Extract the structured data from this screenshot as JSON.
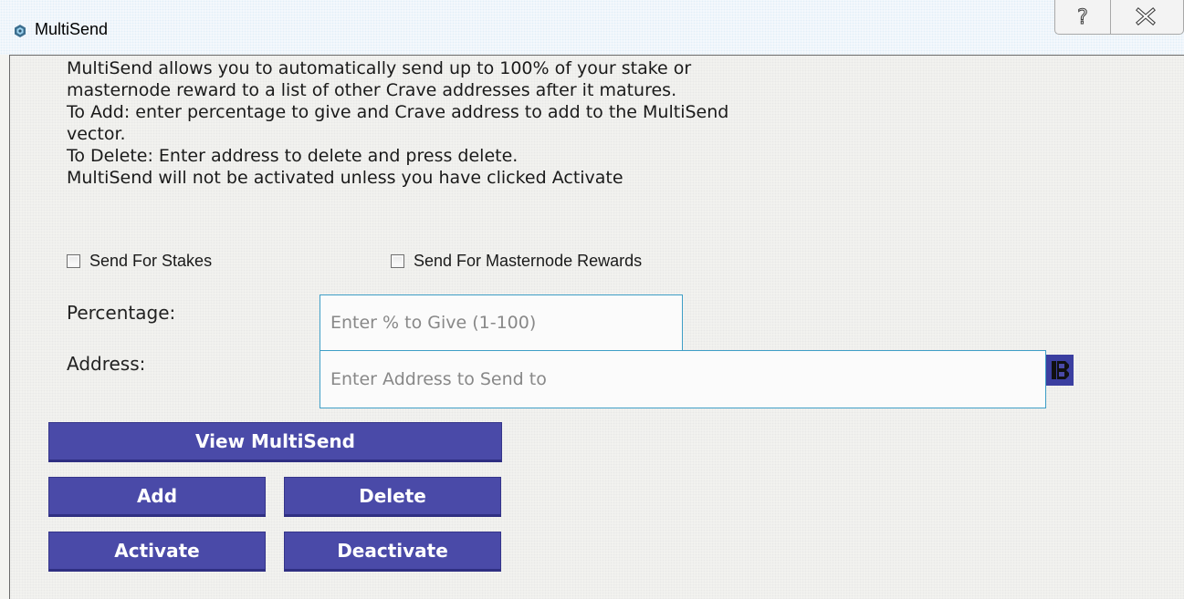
{
  "window": {
    "title": "MultiSend",
    "icons": {
      "app": "multisend-app-icon",
      "help": "help-icon",
      "close": "close-icon",
      "address_book": "address-book-icon"
    }
  },
  "description": {
    "lines": [
      "MultiSend allows you to automatically send up to 100% of your stake or",
      "masternode reward to a list of other Crave addresses after it matures.",
      "To Add: enter percentage to give and Crave address to add to the MultiSend",
      "vector.",
      "To Delete: Enter address to delete and press delete.",
      "MultiSend will not be activated unless you have clicked Activate"
    ]
  },
  "options": {
    "stakes_label": "Send For Stakes",
    "stakes_checked": false,
    "masternode_label": "Send For Masternode Rewards",
    "masternode_checked": false
  },
  "form": {
    "percentage_label": "Percentage:",
    "percentage_placeholder": "Enter % to Give (1-100)",
    "percentage_value": "",
    "address_label": "Address:",
    "address_placeholder": "Enter Address to Send to",
    "address_value": ""
  },
  "buttons": {
    "view": "View MultiSend",
    "add": "Add",
    "delete": "Delete",
    "activate": "Activate",
    "deactivate": "Deactivate"
  },
  "colors": {
    "button_bg": "#4a4aa8",
    "input_border": "#3e9ec6"
  }
}
